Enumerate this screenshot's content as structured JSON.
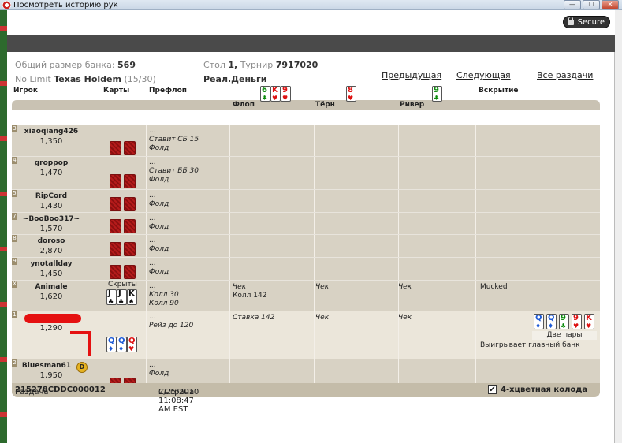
{
  "window": {
    "title": "Посмотреть историю рук",
    "minimize": "—",
    "maximize": "☐",
    "close": "✕"
  },
  "secure": "Secure",
  "info": {
    "pot_label": "Общий размер банка:",
    "pot_value": "569",
    "game_label": "No Limit",
    "game_name": "Texas Holdem",
    "game_seats": "(15/30)",
    "table_label": "Стол",
    "table_value": "1,",
    "tournament_label": "Турнир",
    "tournament_value": "7917020",
    "money": "Реал.Деньги"
  },
  "nav": {
    "prev": "Предыдущая",
    "next": "Следующая",
    "all": "Все раздачи"
  },
  "headers": {
    "player": "Игрок",
    "cards": "Карты",
    "preflop": "Префлоп",
    "showdown": "Вскрытие"
  },
  "board": {
    "flop_label": "Флоп",
    "turn_label": "Тёрн",
    "river_label": "Ривер",
    "flop_cards": [
      {
        "r": "6",
        "c": "grn",
        "s": "♣"
      },
      {
        "r": "K",
        "c": "red",
        "s": "♥"
      },
      {
        "r": "9",
        "c": "red",
        "s": "♥"
      }
    ],
    "turn_cards": [
      {
        "r": "8",
        "c": "red",
        "s": "♥"
      }
    ],
    "river_cards": [
      {
        "r": "9",
        "c": "grn",
        "s": "♣"
      }
    ]
  },
  "players": [
    {
      "seat": "3",
      "name": "xiaoqiang426",
      "stack": "1,350",
      "pre": [
        "...",
        "Ставит СБ 15",
        "Фолд"
      ]
    },
    {
      "seat": "4",
      "name": "groppop",
      "stack": "1,470",
      "pre": [
        "...",
        "Ставит ББ 30",
        "Фолд"
      ]
    },
    {
      "seat": "5",
      "name": "RipCord",
      "stack": "1,430",
      "pre": [
        "...",
        "Фолд"
      ]
    },
    {
      "seat": "7",
      "name": "~BooBoo317~",
      "stack": "1,570",
      "pre": [
        "...",
        "Фолд"
      ]
    },
    {
      "seat": "8",
      "name": "doroso",
      "stack": "2,870",
      "pre": [
        "...",
        "Фолд"
      ]
    },
    {
      "seat": "9",
      "name": "ynotallday",
      "stack": "1,450",
      "pre": [
        "...",
        "Фолд"
      ]
    },
    {
      "seat": "X",
      "name": "Animale",
      "stack": "1,620",
      "cards_label": "Скрыты",
      "pre": [
        "...",
        "Колл 30",
        "Колл 90"
      ],
      "flop": [
        "Чек",
        "Колл 142"
      ],
      "turn": "Чек",
      "river": "Чек",
      "showdown": "Mucked"
    },
    {
      "seat": "1",
      "name": "",
      "stack": "1,290",
      "pre": [
        "...",
        "Рейз до 120"
      ],
      "flop": [
        "Ставка 142"
      ],
      "turn": "Чек",
      "river": "Чек",
      "hand": "Две пары",
      "result": "Выигрывает главный банк"
    },
    {
      "seat": "2",
      "name": "Bluesman61",
      "stack": "1,950",
      "pre": [
        "...",
        "Фолд"
      ],
      "dealer": "D"
    }
  ],
  "animale_cards": [
    {
      "r": "J",
      "c": "blk",
      "s": "♣"
    },
    {
      "r": "J",
      "c": "blk",
      "s": "♣"
    },
    {
      "r": "K",
      "c": "blk",
      "s": "♠"
    }
  ],
  "hero_cards": [
    {
      "r": "Q",
      "c": "blu",
      "s": "♦"
    },
    {
      "r": "Q",
      "c": "blu",
      "s": "♦"
    },
    {
      "r": "Q",
      "c": "red",
      "s": "♥"
    }
  ],
  "best_hand": [
    {
      "r": "Q",
      "c": "blu",
      "s": "♦"
    },
    {
      "r": "Q",
      "c": "blu",
      "s": "♦"
    },
    {
      "r": "9",
      "c": "grn",
      "s": "♣"
    },
    {
      "r": "9",
      "c": "red",
      "s": "♥"
    },
    {
      "r": "K",
      "c": "red",
      "s": "♥"
    }
  ],
  "footer": {
    "hand_label": "Раздача",
    "hand_id": "215278CDDC000012",
    "played_label": "Сыграна",
    "played_value": "2/25/2010 11:08:47 AM EST",
    "deck_label": "4-хцветная колода",
    "check": "✔"
  }
}
